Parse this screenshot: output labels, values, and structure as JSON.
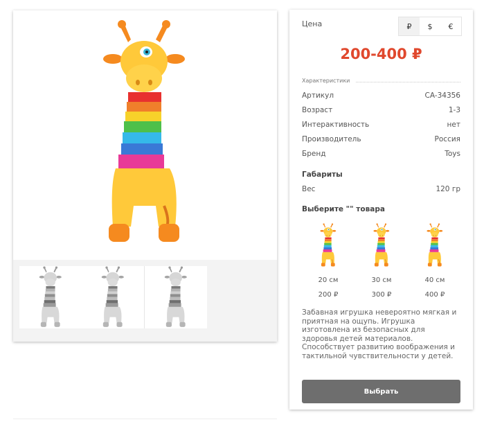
{
  "product": {
    "image_alt": "rainbow-giraffe-plush",
    "thumbnails": [
      "giraffe-thumb",
      "giraffe-thumb",
      "giraffe-thumb"
    ]
  },
  "price": {
    "label": "Цена",
    "value": "200-400 ₽",
    "currencies": [
      "₽",
      "$",
      "€"
    ],
    "active_currency": "₽",
    "accent_color": "#e0482d"
  },
  "characteristics": {
    "title": "Характеристики",
    "rows": [
      {
        "key": "Артикул",
        "value": "CA-34356"
      },
      {
        "key": "Возраст",
        "value": "1-3"
      },
      {
        "key": "Интерактивность",
        "value": "нет"
      },
      {
        "key": "Производитель",
        "value": "Россия"
      },
      {
        "key": "Бренд",
        "value": "Toys"
      }
    ]
  },
  "dimensions": {
    "title": "Габариты",
    "rows": [
      {
        "key": "Вес",
        "value": "120 гр"
      }
    ]
  },
  "variants": {
    "title": "Выберите \"\" товара",
    "items": [
      {
        "size": "20 см",
        "price": "200 ₽"
      },
      {
        "size": "30 см",
        "price": "300 ₽"
      },
      {
        "size": "40 см",
        "price": "400 ₽"
      }
    ]
  },
  "description": "Забавная игрушка невероятно мягкая и приятная на ощупь. Игрушка изготовлена из безопасных для здоровья детей материалов. Способствует развитию воображения и тактильной чувствительности у детей.",
  "buy_button": {
    "label": "Выбрать",
    "color": "#6e6e6e"
  }
}
